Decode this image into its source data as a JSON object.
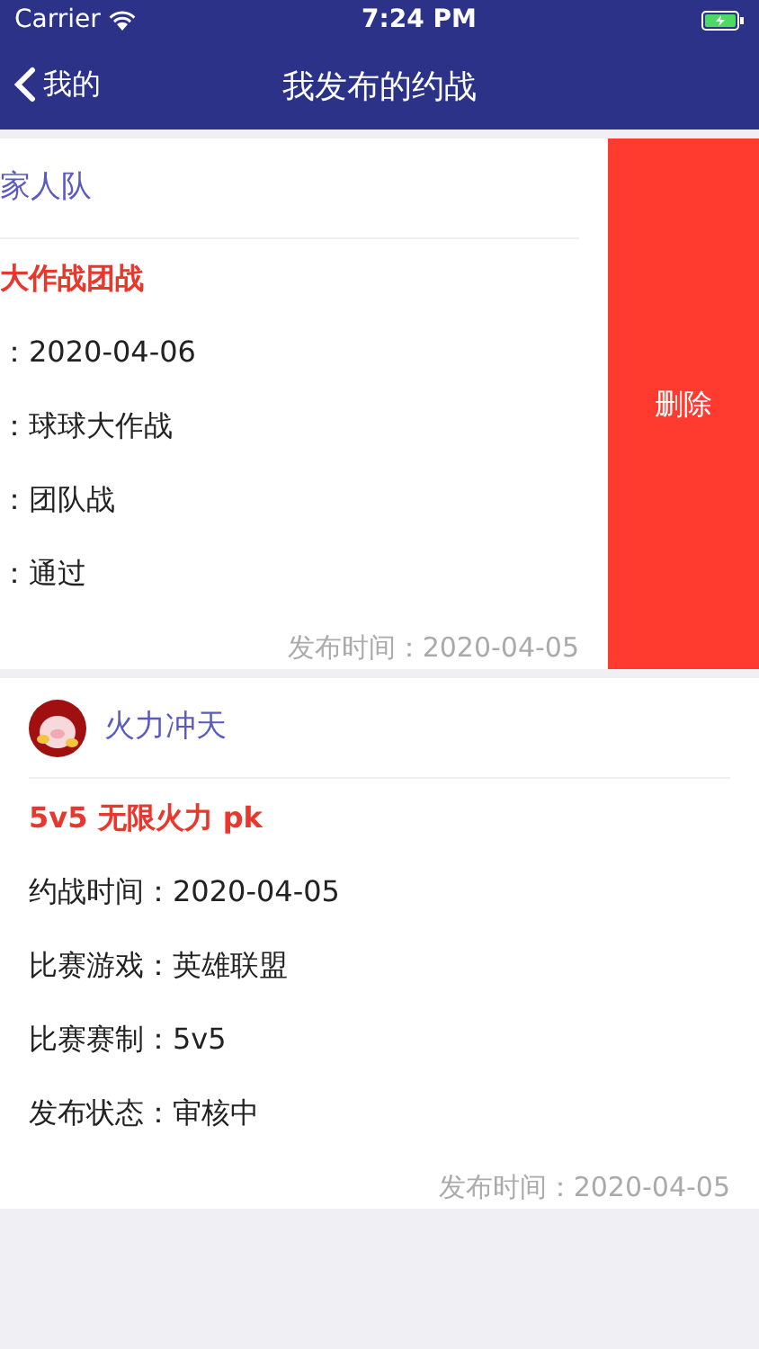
{
  "status_bar": {
    "carrier": "Carrier",
    "time": "7:24 PM"
  },
  "nav": {
    "back": "我的",
    "title": "我发布的约战"
  },
  "cards": [
    {
      "swiped": true,
      "has_avatar": false,
      "team": "家人队",
      "title": "大作战团战",
      "rows": [
        {
          "label": "：",
          "value": "2020-04-06"
        },
        {
          "label": "：",
          "value": "球球大作战"
        },
        {
          "label": "：",
          "value": "团队战"
        },
        {
          "label": "：",
          "value": "通过"
        }
      ],
      "published": "发布时间：2020-04-05",
      "delete": "删除"
    },
    {
      "swiped": false,
      "has_avatar": true,
      "team": "火力冲天",
      "title": "5v5 无限火力 pk",
      "rows": [
        {
          "label": "约战时间：",
          "value": "2020-04-05"
        },
        {
          "label": "比赛游戏：",
          "value": "英雄联盟"
        },
        {
          "label": "比赛赛制：",
          "value": "5v5"
        },
        {
          "label": "发布状态：",
          "value": "审核中"
        }
      ],
      "published": "发布时间：2020-04-05"
    }
  ]
}
